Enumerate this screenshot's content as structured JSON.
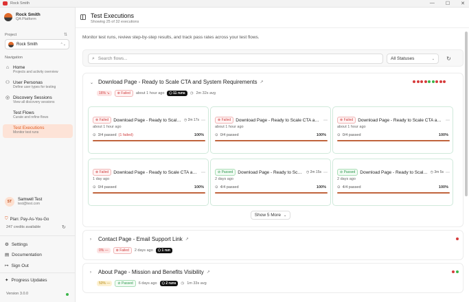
{
  "window": {
    "title": "Rock Smith",
    "controls": [
      "—",
      "☐",
      "✕"
    ]
  },
  "sidebar": {
    "app_name": "Rock Smith",
    "app_sub": "QA Platform",
    "project_label": "Project",
    "project_name": "Rock Smith",
    "navigation_label": "Navigation",
    "items": [
      {
        "title": "Home",
        "sub": "Projects and activity overview",
        "icon": "home-icon"
      },
      {
        "title": "User Personas",
        "sub": "Define user types for testing",
        "icon": "user-icon"
      },
      {
        "title": "Discovery Sessions",
        "sub": "View all discovery sessions",
        "icon": "compass-icon"
      },
      {
        "title": "Test Flows",
        "sub": "Curate and refine flows",
        "icon": "flow-icon"
      },
      {
        "title": "Test Executions",
        "sub": "Monitor test runs",
        "icon": "play-icon"
      }
    ],
    "account": {
      "initials": "ST",
      "name": "Samwell Test",
      "email": "test@test.com"
    },
    "plan": "Plan: Pay-As-You-Go",
    "credits": "247 credits available",
    "links": {
      "settings": "Settings",
      "documentation": "Documentation",
      "sign_out": "Sign Out",
      "progress": "Progress Updates"
    },
    "version": "Version 3.0.0"
  },
  "header": {
    "title": "Test Executions",
    "subtitle": "Showing 25 of 32 executions",
    "description": "Monitor test runs, review step-by-step results, and track pass rates across your test flows."
  },
  "filters": {
    "search_placeholder": "Search flows...",
    "status": "All Statuses"
  },
  "groups": [
    {
      "title": "Download Page - Ready to Scale CTA and System Requirements",
      "pct": "16% ↘",
      "status": "Failed",
      "time": "about 1 hour ago",
      "runs": "11 runs",
      "avg": "2m 32s avg",
      "dots": [
        "#d63c3c",
        "#d63c3c",
        "#d63c3c",
        "#d63c3c",
        "#3bb54a",
        "#3bb54a",
        "#d63c3c",
        "#d63c3c",
        "#d63c3c"
      ],
      "cards": [
        {
          "status": "Failed",
          "title": "Download Page - Ready to Scale CTA and System Requirements",
          "dur": "2m 17s",
          "time": "about 1 hour ago",
          "passed": "3/4 passed",
          "failnote": "(1 failed)",
          "pct": "100%",
          "fill": 1.0
        },
        {
          "status": "Failed",
          "title": "Download Page - Ready to Scale CTA and System Requirements",
          "dur": "",
          "time": "about 1 hour ago",
          "passed": "0/4 passed",
          "failnote": "",
          "pct": "100%",
          "fill": 1.0
        },
        {
          "status": "Failed",
          "title": "Download Page - Ready to Scale CTA and System Requirements",
          "dur": "",
          "time": "about 1 hour ago",
          "passed": "0/4 passed",
          "failnote": "",
          "pct": "100%",
          "fill": 1.0
        },
        {
          "status": "Failed",
          "title": "Download Page - Ready to Scale CTA and System Requirements",
          "dur": "",
          "time": "1 day ago",
          "passed": "0/4 passed",
          "failnote": "",
          "pct": "100%",
          "fill": 1.0
        },
        {
          "status": "Passed",
          "title": "Download Page - Ready to Scale CTA and System Requirements",
          "dur": "2m 15s",
          "time": "2 days ago",
          "passed": "4/4 passed",
          "failnote": "",
          "pct": "100%",
          "fill": 1.0
        },
        {
          "status": "Passed",
          "title": "Download Page - Ready to Scale CTA and System Requirements",
          "dur": "3m 5s",
          "time": "2 days ago",
          "passed": "4/4 passed",
          "failnote": "",
          "pct": "100%",
          "fill": 1.0
        }
      ],
      "show_more": "Show 5 More"
    },
    {
      "title": "Contact Page - Email Support Link",
      "pct": "0% —",
      "status": "Failed",
      "time": "2 days ago",
      "runs": "1 run",
      "avg": "",
      "dots": [
        "#d63c3c"
      ]
    },
    {
      "title": "About Page - Mission and Benefits Visibility",
      "pct": "50% —",
      "status": "Passed",
      "time": "6 days ago",
      "runs": "2 runs",
      "avg": "1m 33s avg",
      "dots": [
        "#d63c3c",
        "#3bb54a"
      ]
    }
  ]
}
